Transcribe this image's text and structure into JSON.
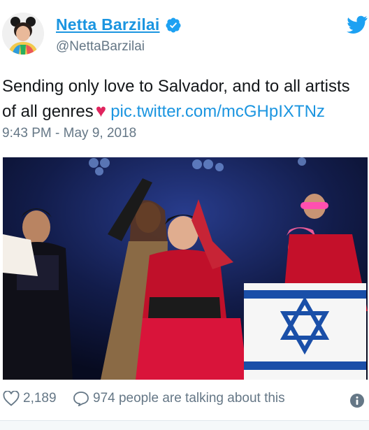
{
  "user": {
    "display_name": "Netta Barzilai",
    "handle": "@NettaBarzilai",
    "verified": true
  },
  "tweet": {
    "text_line1": "Sending only love to Salvador, and to all artists",
    "text_line2": "of all genres",
    "emoji": "♥",
    "link": "pic.twitter.com/mcGHpIXTNz",
    "timestamp": "9:43 PM - May 9, 2018"
  },
  "footer": {
    "likes": "2,189",
    "replies_text": "974 people are talking about this"
  },
  "icons": {
    "logo": "twitter-bird-icon",
    "verified": "verified-badge-icon",
    "like": "heart-icon",
    "reply": "reply-bubble-icon",
    "info": "info-icon"
  },
  "colors": {
    "accent": "#1b95e0",
    "text": "#14171a",
    "muted": "#657786",
    "heart": "#e0245e"
  }
}
